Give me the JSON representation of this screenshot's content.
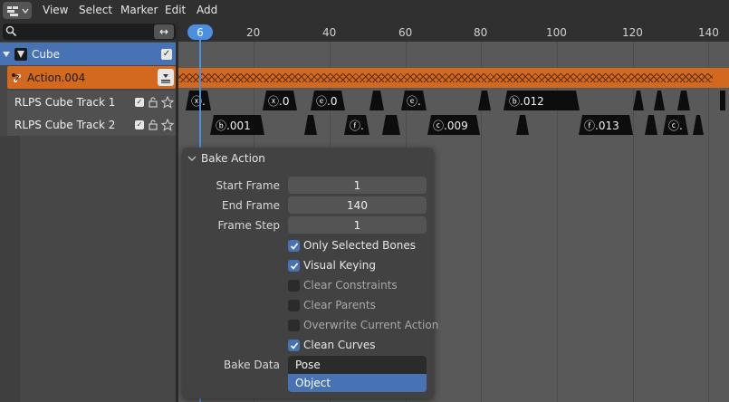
{
  "menubar": {
    "items": [
      "View",
      "Select",
      "Marker",
      "Edit",
      "Add"
    ]
  },
  "channels": {
    "swap_icon": "↔",
    "object": {
      "label": "Cube"
    },
    "action": {
      "label": "Action.004"
    },
    "tracks": [
      {
        "label": "RLPS Cube Track 1"
      },
      {
        "label": "RLPS Cube Track 2"
      }
    ]
  },
  "timeline": {
    "current_frame": "6",
    "ticks": [
      "20",
      "40",
      "60",
      "80",
      "100",
      "120",
      "140"
    ],
    "track1_strips": [
      "ⓧ.",
      "ⓧ.0",
      "ⓔ.0",
      "",
      "ⓔ.",
      "",
      "ⓑ.012",
      "",
      "",
      ""
    ],
    "track2_strips": [
      "ⓑ.001",
      "",
      "ⓕ.",
      "",
      "ⓒ.009",
      "",
      "ⓕ.013",
      "",
      "ⓒ.",
      ""
    ]
  },
  "bake_action": {
    "title": "Bake Action",
    "start_frame_label": "Start Frame",
    "start_frame_value": "1",
    "end_frame_label": "End Frame",
    "end_frame_value": "140",
    "frame_step_label": "Frame Step",
    "frame_step_value": "1",
    "options": [
      {
        "label": "Only Selected Bones",
        "checked": true
      },
      {
        "label": "Visual Keying",
        "checked": true
      },
      {
        "label": "Clear Constraints",
        "checked": false
      },
      {
        "label": "Clear Parents",
        "checked": false
      },
      {
        "label": "Overwrite Current Action",
        "checked": false
      },
      {
        "label": "Clean Curves",
        "checked": true
      }
    ],
    "bake_data_label": "Bake Data",
    "bake_data_options": [
      "Pose",
      "Object"
    ],
    "bake_data_highlighted": "Object"
  },
  "colors": {
    "accent": "#4772b3",
    "action": "#d2691e",
    "playhead": "#4a8fe0"
  }
}
